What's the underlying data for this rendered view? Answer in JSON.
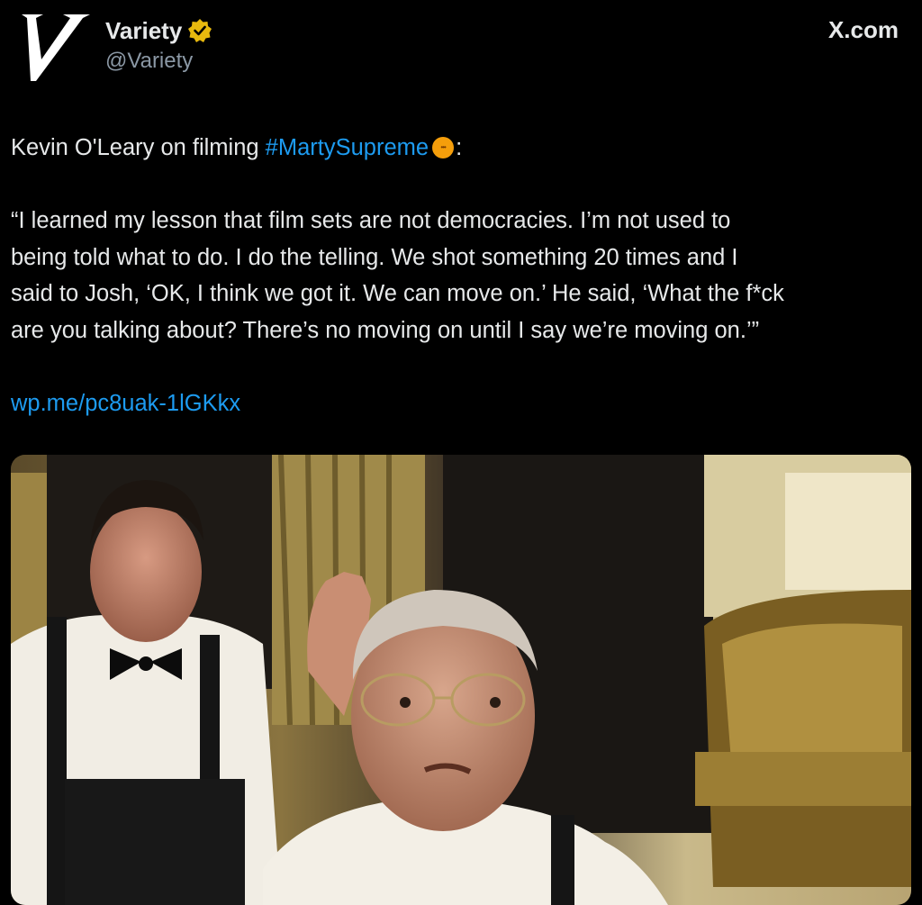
{
  "account": {
    "display_name": "Variety",
    "handle": "@Variety",
    "verified_badge_color": "#e8b90e",
    "avatar_letter": "V"
  },
  "source_label": "X.com",
  "tweet": {
    "intro_prefix": "Kevin O'Leary on filming ",
    "hashtag": "#MartySupreme",
    "intro_suffix": ":",
    "quote_lines": [
      "“I learned my lesson that film sets are not democracies. I’m not used to",
      "being told what to do. I do the telling. We shot something 20 times and I",
      "said to Josh, ‘OK, I think we got it. We can move on.’ He said, ‘What the f*ck",
      "are you talking about? There’s no moving on until I say we’re moving on.’”"
    ],
    "link": "wp.me/pc8uak-1lGKkx"
  },
  "colors": {
    "background": "#000000",
    "text": "#e7e9ea",
    "secondary_text": "#8b98a5",
    "link": "#1d9bf0"
  }
}
